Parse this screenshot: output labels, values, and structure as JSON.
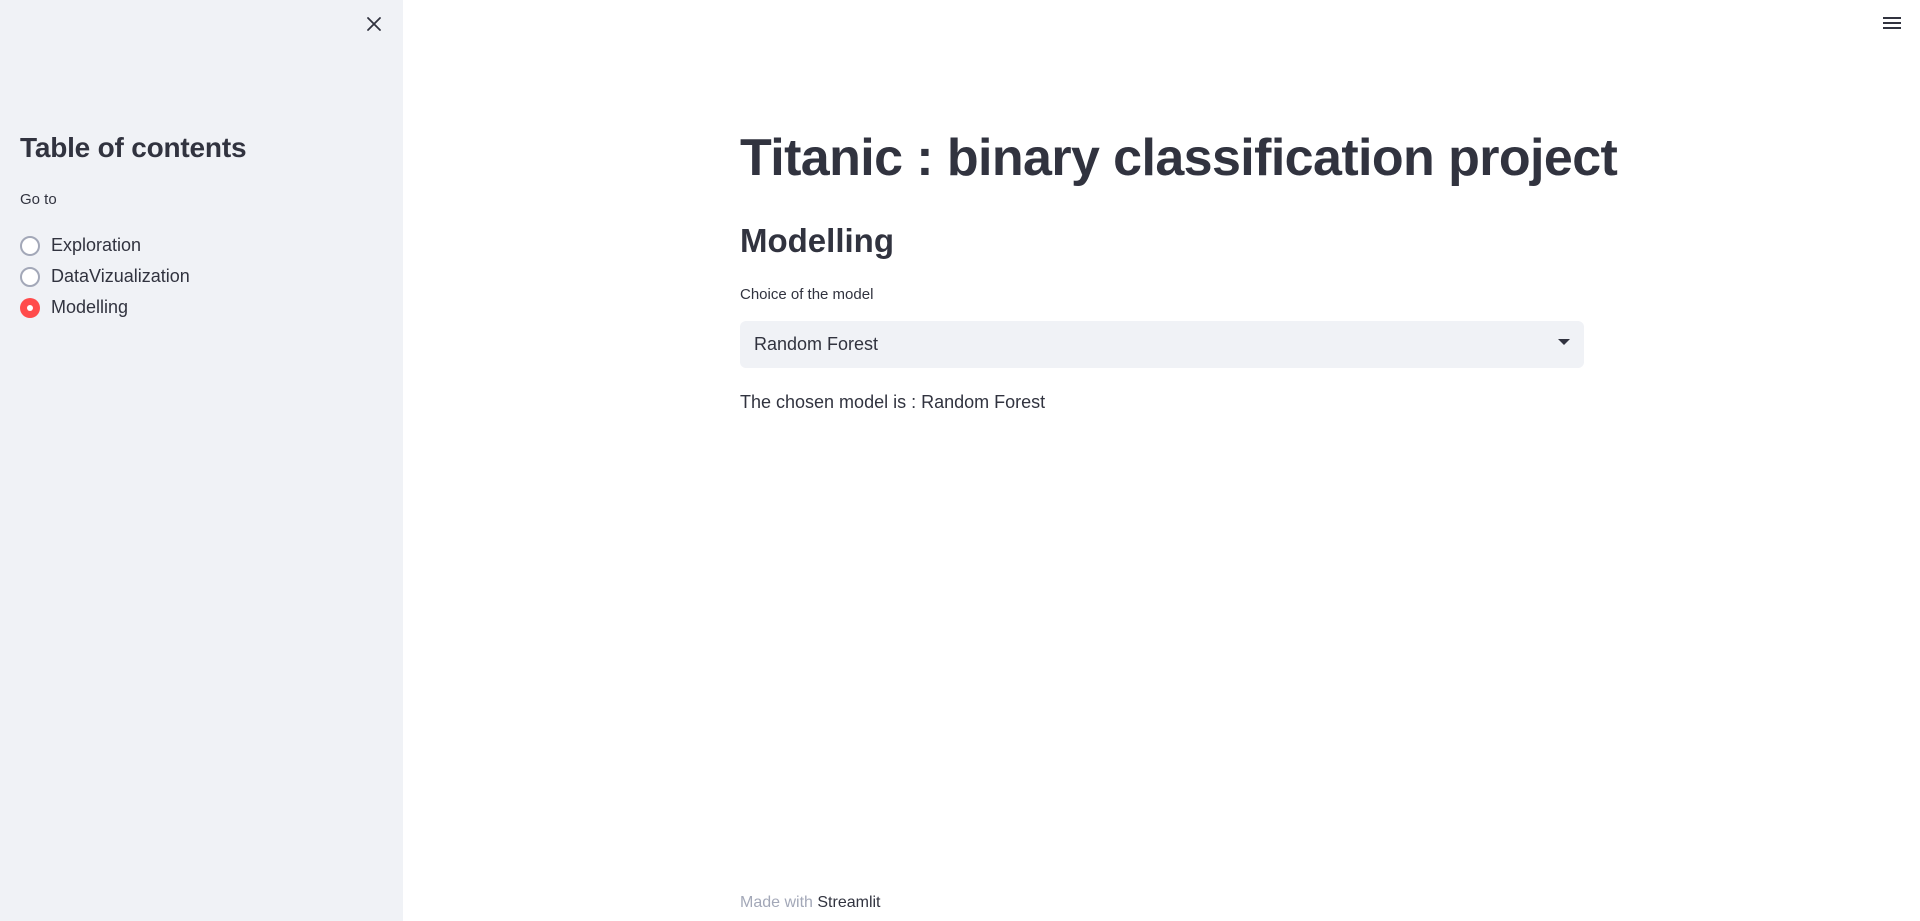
{
  "sidebar": {
    "title": "Table of contents",
    "radio_label": "Go to",
    "options": [
      {
        "label": "Exploration",
        "selected": false
      },
      {
        "label": "DataVizualization",
        "selected": false
      },
      {
        "label": "Modelling",
        "selected": true
      }
    ]
  },
  "main": {
    "title": "Titanic : binary classification project",
    "section_title": "Modelling",
    "select": {
      "label": "Choice of the model",
      "value": "Random Forest"
    },
    "result_text": "The chosen model is : Random Forest"
  },
  "footer": {
    "prefix": "Made with",
    "link": "Streamlit"
  },
  "colors": {
    "accent": "#ff4b4b",
    "sidebar_bg": "#f0f2f6",
    "text": "#31333f",
    "muted": "#a3a8b8"
  },
  "icons": {
    "close": "close-icon",
    "menu": "hamburger-menu-icon",
    "dropdown": "chevron-down-icon"
  }
}
